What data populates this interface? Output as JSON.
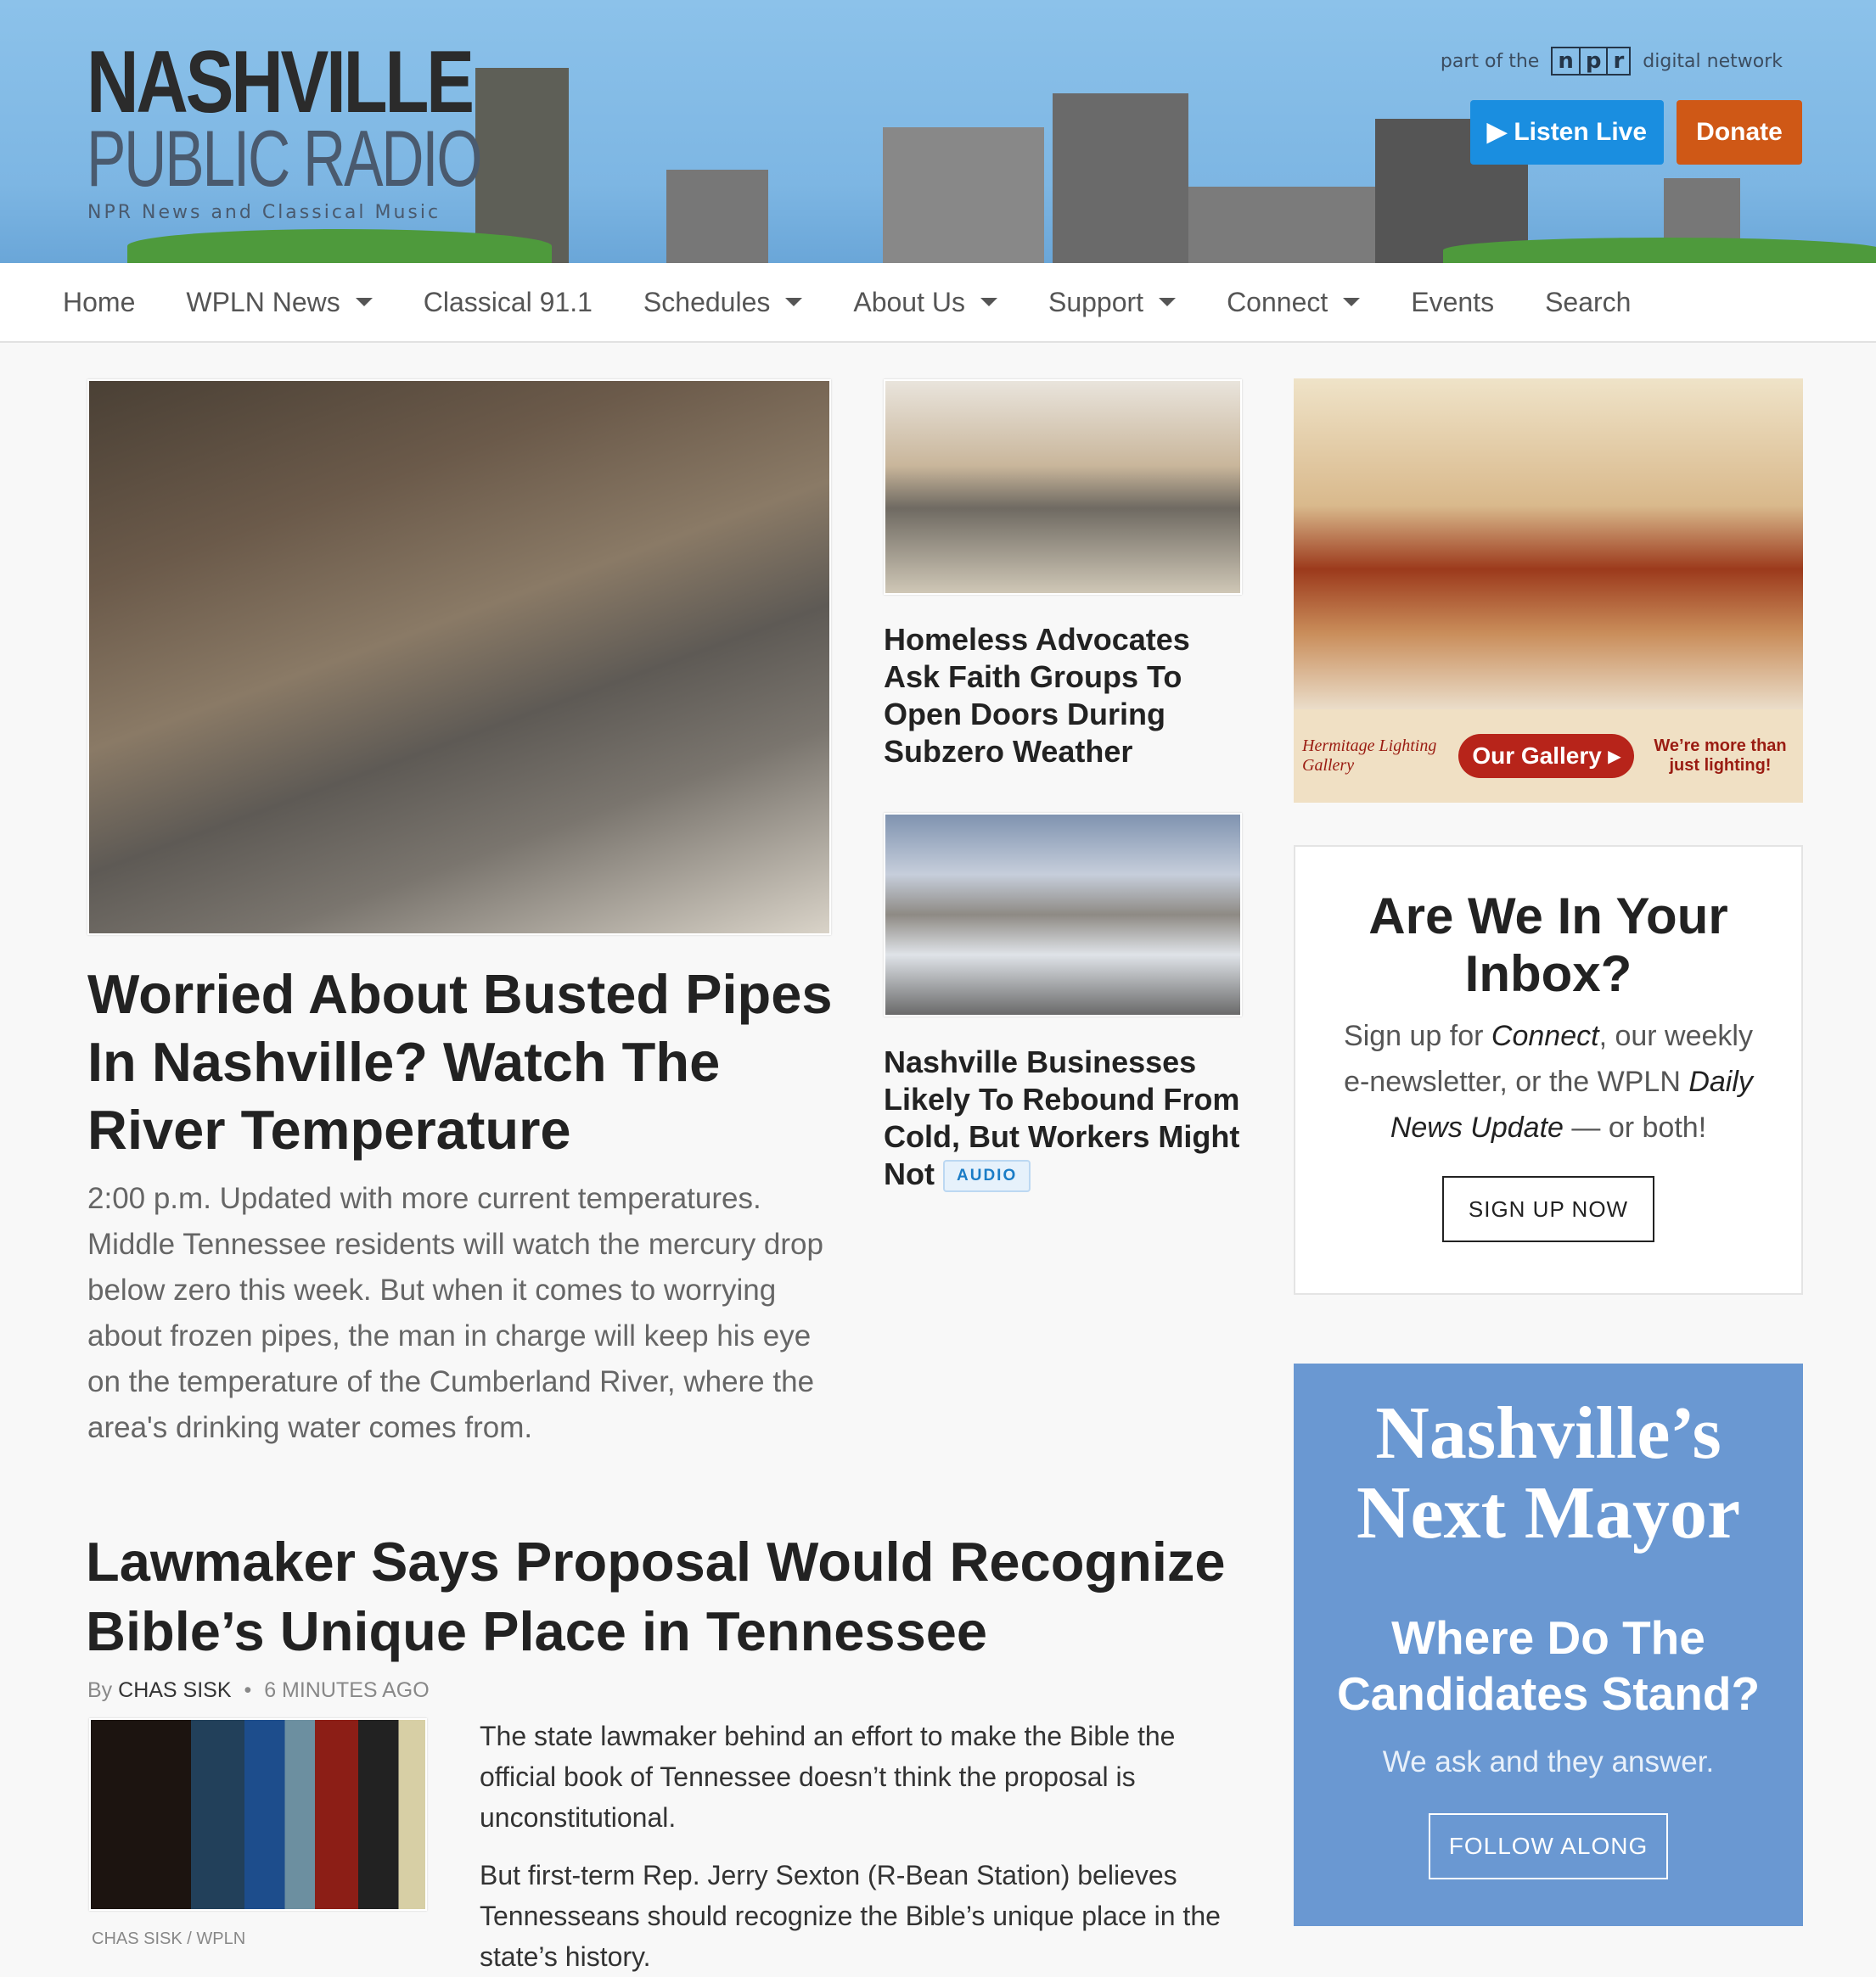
{
  "header": {
    "logo_line1": "NASHVILLE",
    "logo_line2": "PUBLIC RADIO",
    "logo_tagline": "NPR News and Classical Music",
    "npr_prefix": "part of the",
    "npr_letters": [
      "n",
      "p",
      "r"
    ],
    "npr_suffix": "digital network",
    "listen_live": "Listen Live",
    "donate": "Donate",
    "colors": {
      "listen": "#1a8ee0",
      "donate": "#cf5816"
    }
  },
  "nav": [
    {
      "label": "Home",
      "dropdown": false
    },
    {
      "label": "WPLN News",
      "dropdown": true
    },
    {
      "label": "Classical 91.1",
      "dropdown": false
    },
    {
      "label": "Schedules",
      "dropdown": true
    },
    {
      "label": "About Us",
      "dropdown": true
    },
    {
      "label": "Support",
      "dropdown": true
    },
    {
      "label": "Connect",
      "dropdown": true
    },
    {
      "label": "Events",
      "dropdown": false
    },
    {
      "label": "Search",
      "dropdown": false
    }
  ],
  "lead": {
    "title": "Worried About Busted Pipes In Nashville? Watch The River Temperature",
    "summary": "2:00 p.m. Updated with more current temperatures. Middle Tennessee residents will watch the mercury drop below zero this week. But when it comes to worrying about frozen pipes, the man in charge will keep his eye on the temperature of the Cumberland River, where the area's drinking water comes from."
  },
  "side_stories": [
    {
      "title": "Homeless Advocates Ask Faith Groups To Open Doors During Subzero Weather"
    },
    {
      "title": "Nashville Businesses Likely To Rebound From Cold, But Workers Might Not",
      "badge": "AUDIO"
    }
  ],
  "story2": {
    "title": "Lawmaker Says Proposal Would Recognize Bible’s Unique Place in Tennessee",
    "by": "By",
    "author": "CHAS SISK",
    "time": "6 MINUTES AGO",
    "credit": "CHAS SISK / WPLN",
    "para1": "The state lawmaker behind an effort to make the Bible the official book of Tennessee doesn’t think the proposal is unconstitutional.",
    "para2": "But first-term Rep. Jerry Sexton (R-Bean Station) believes Tennesseans should recognize the Bible’s unique place in the state’s history."
  },
  "ad": {
    "brand": "Hermitage Lighting Gallery",
    "cta": "Our Gallery",
    "tagline": "We’re more than just lighting!"
  },
  "newsletter": {
    "title": "Are We In Your Inbox?",
    "text_a": "Sign up for ",
    "em1": "Connect",
    "text_b": ", our weekly e-newsletter, or the WPLN ",
    "em2": "Daily News Update",
    "text_c": " — or both!",
    "button": "SIGN UP NOW"
  },
  "mayor": {
    "title": "Nashville’s Next Mayor",
    "subtitle": "Where Do The Candidates Stand?",
    "text": "We ask and they answer.",
    "button": "FOLLOW ALONG",
    "color": "#6a98d2"
  }
}
